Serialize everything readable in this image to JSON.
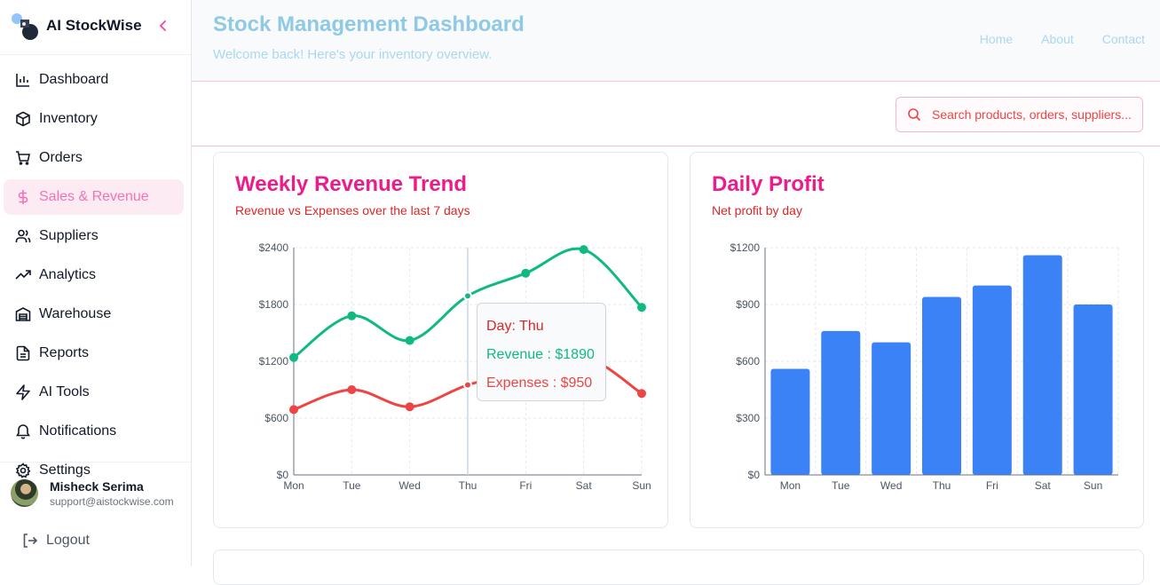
{
  "brand": {
    "name": "AI StockWise"
  },
  "nav": [
    {
      "label": "Dashboard",
      "icon": "bar-chart-icon",
      "active": false
    },
    {
      "label": "Inventory",
      "icon": "package-icon",
      "active": false
    },
    {
      "label": "Orders",
      "icon": "cart-icon",
      "active": false
    },
    {
      "label": "Sales & Revenue",
      "icon": "dollar-icon",
      "active": true
    },
    {
      "label": "Suppliers",
      "icon": "users-icon",
      "active": false
    },
    {
      "label": "Analytics",
      "icon": "trending-up-icon",
      "active": false
    },
    {
      "label": "Warehouse",
      "icon": "warehouse-icon",
      "active": false
    },
    {
      "label": "Reports",
      "icon": "file-text-icon",
      "active": false
    },
    {
      "label": "AI Tools",
      "icon": "zap-icon",
      "active": false
    },
    {
      "label": "Notifications",
      "icon": "bell-icon",
      "active": false
    },
    {
      "label": "Settings",
      "icon": "gear-icon",
      "active": false
    }
  ],
  "user": {
    "name": "Misheck Serima",
    "email": "support@aistockwise.com"
  },
  "logout_label": "Logout",
  "header": {
    "title": "Stock Management Dashboard",
    "subtitle": "Welcome back! Here's your inventory overview.",
    "links": [
      "Home",
      "About",
      "Contact"
    ]
  },
  "search": {
    "placeholder": "Search products, orders, suppliers..."
  },
  "colors": {
    "revenue": "#10b981",
    "expenses": "#ef4444",
    "profit": "#3b82f6",
    "accent": "#ec1c8c"
  },
  "cards": {
    "revenue": {
      "title": "Weekly Revenue Trend",
      "subtitle": "Revenue vs Expenses over the last 7 days"
    },
    "profit": {
      "title": "Daily Profit",
      "subtitle": "Net profit by day"
    }
  },
  "tooltip": {
    "day": "Day: Thu",
    "revenue": "Revenue : $1890",
    "expenses": "Expenses : $950"
  },
  "chart_data": [
    {
      "type": "line",
      "categories": [
        "Mon",
        "Tue",
        "Wed",
        "Thu",
        "Fri",
        "Sat",
        "Sun"
      ],
      "series": [
        {
          "name": "Revenue",
          "values": [
            1240,
            1680,
            1420,
            1890,
            2130,
            2380,
            1770
          ]
        },
        {
          "name": "Expenses",
          "values": [
            690,
            900,
            720,
            950,
            1100,
            1250,
            860
          ]
        }
      ],
      "yticks": [
        "$0",
        "$600",
        "$1200",
        "$1800",
        "$2400"
      ],
      "ylim": [
        0,
        2400
      ],
      "grid": true
    },
    {
      "type": "bar",
      "categories": [
        "Mon",
        "Tue",
        "Wed",
        "Thu",
        "Fri",
        "Sat",
        "Sun"
      ],
      "values": [
        560,
        760,
        700,
        940,
        1000,
        1160,
        900
      ],
      "yticks": [
        "$0",
        "$300",
        "$600",
        "$900",
        "$1200"
      ],
      "ylim": [
        0,
        1200
      ],
      "grid": true
    }
  ]
}
